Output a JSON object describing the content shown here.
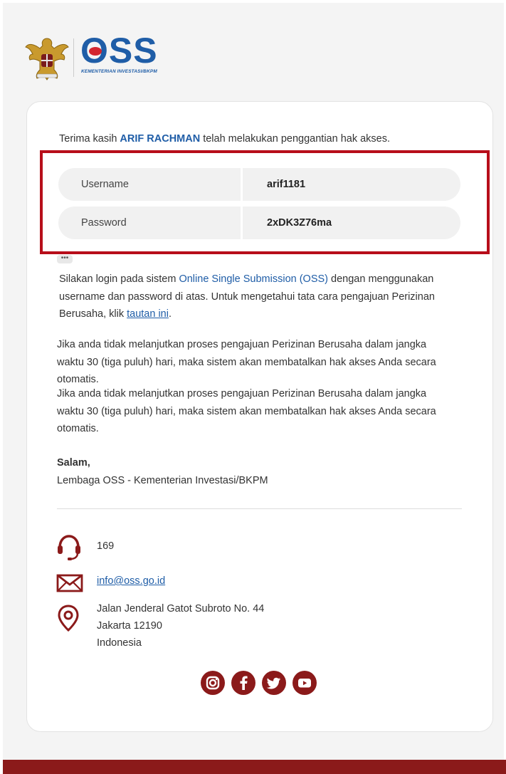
{
  "logo": {
    "brand": "OSS",
    "subtitle": "KEMENTERIAN INVESTASI/BKPM"
  },
  "greeting": {
    "prefix": "Terima kasih ",
    "name": "ARIF RACHMAN",
    "suffix": " telah melakukan penggantian hak akses."
  },
  "credentials": [
    {
      "label": "Username",
      "value": "arif1181"
    },
    {
      "label": "Password",
      "value": "2xDK3Z76ma"
    }
  ],
  "more_indicator": "•••",
  "login_paragraph": {
    "line1_a": "Silakan login pada sistem ",
    "line1_link": "Online Single Submission (OSS)",
    "line1_b": " dengan menggunakan",
    "line2": "username dan password di atas. Untuk mengetahui tata cara pengajuan Perizinan",
    "line3_a": "Berusaha, klik ",
    "line3_link": "tautan ini",
    "line3_b": "."
  },
  "warning_1": {
    "line1": "Jika anda tidak melanjutkan proses pengajuan Perizinan Berusaha dalam jangka",
    "line2": "waktu 30 (tiga puluh) hari, maka sistem akan membatalkan hak akses Anda secara",
    "line3": "otomatis."
  },
  "warning_2": {
    "line1": "Jika anda tidak melanjutkan proses pengajuan Perizinan Berusaha dalam jangka",
    "line2": "waktu 30 (tiga puluh) hari, maka sistem akan membatalkan hak akses Anda secara",
    "line3": "otomatis."
  },
  "signoff": {
    "salutation": "Salam,",
    "org": "Lembaga OSS - Kementerian Investasi/BKPM"
  },
  "contact": {
    "phone": "169",
    "email": "info@oss.go.id",
    "address_line1": "Jalan Jenderal Gatot Subroto No. 44",
    "address_line2": "Jakarta 12190",
    "address_line3": "Indonesia"
  },
  "social_icons": [
    "instagram-icon",
    "facebook-icon",
    "twitter-icon",
    "youtube-icon"
  ],
  "colors": {
    "brand_blue": "#1f5da7",
    "brand_red": "#8b1a1a",
    "highlight_frame": "#b70e1a"
  }
}
